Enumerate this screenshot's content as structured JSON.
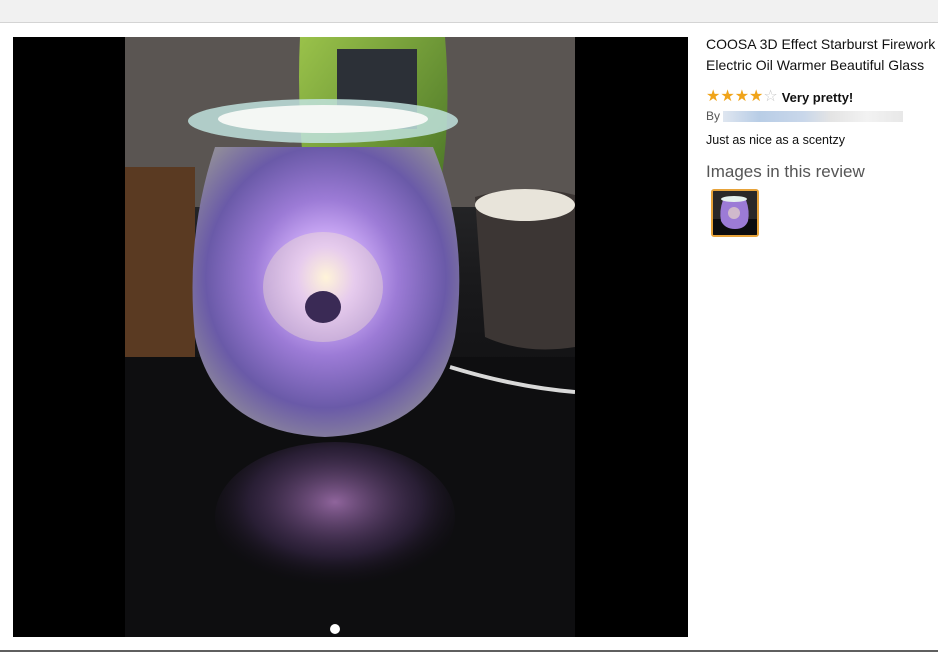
{
  "review": {
    "product_title_line1": "COOSA 3D Effect Starburst Firework",
    "product_title_line2": "Electric Oil Warmer Beautiful Glass",
    "rating": 4,
    "rating_max": 5,
    "review_title": "Very pretty!",
    "by_label": "By",
    "body": "Just as nice as a scentzy",
    "images_heading": "Images in this review"
  },
  "colors": {
    "star": "#f0a41a",
    "thumb_border": "#e7a33a",
    "viewer_bg": "#000000"
  },
  "icons": {
    "star_filled": "star-icon",
    "star_empty": "star-empty-icon"
  }
}
